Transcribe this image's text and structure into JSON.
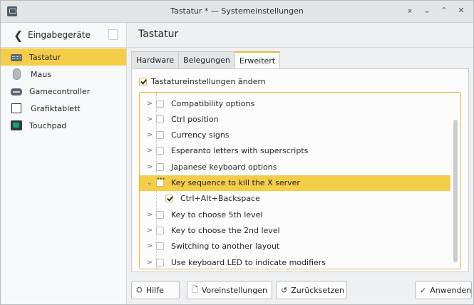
{
  "window": {
    "title": "Tastatur * — Systemeinstellungen",
    "buttons": [
      "⌅",
      "⌄",
      "⌃",
      "✕"
    ]
  },
  "sidebar": {
    "title": "Eingabegeräte",
    "items": [
      {
        "label": "Tastatur",
        "icon": "keyboard-icon",
        "active": true
      },
      {
        "label": "Maus",
        "icon": "mouse-icon",
        "active": false
      },
      {
        "label": "Gamecontroller",
        "icon": "gamepad-icon",
        "active": false
      },
      {
        "label": "Grafiktablett",
        "icon": "tablet-icon",
        "active": false
      },
      {
        "label": "Touchpad",
        "icon": "touchpad-icon",
        "active": false
      }
    ]
  },
  "main": {
    "title": "Tastatur",
    "tabs": [
      {
        "label": "Hardware",
        "active": false
      },
      {
        "label": "Belegungen",
        "active": false
      },
      {
        "label": "Erweitert",
        "active": true
      }
    ],
    "toggle_label": "Tastatureinstellungen ändern",
    "toggle_checked": true,
    "options": [
      {
        "label": "Compatibility options",
        "state": "unchecked",
        "level": 0
      },
      {
        "label": "Ctrl position",
        "state": "unchecked",
        "level": 0
      },
      {
        "label": "Currency signs",
        "state": "unchecked",
        "level": 0
      },
      {
        "label": "Esperanto letters with superscripts",
        "state": "unchecked",
        "level": 0
      },
      {
        "label": "Japanese keyboard options",
        "state": "unchecked",
        "level": 0
      },
      {
        "label": "Key sequence to kill the X server",
        "state": "partial",
        "level": 0,
        "expanded": true,
        "selected": true
      },
      {
        "label": "Ctrl+Alt+Backspace",
        "state": "checked",
        "level": 1
      },
      {
        "label": "Key to choose 5th level",
        "state": "unchecked",
        "level": 0
      },
      {
        "label": "Key to choose the 2nd level",
        "state": "unchecked",
        "level": 0
      },
      {
        "label": "Switching to another layout",
        "state": "unchecked",
        "level": 0
      },
      {
        "label": "Use keyboard LED to indicate modifiers",
        "state": "unchecked",
        "level": 0
      }
    ]
  },
  "buttons": {
    "help": "Hilfe",
    "defaults": "Voreinstellungen",
    "reset": "Zurücksetzen",
    "apply": "Anwenden"
  },
  "colors": {
    "accent": "#f4cd49",
    "focus": "#e6b93a"
  }
}
